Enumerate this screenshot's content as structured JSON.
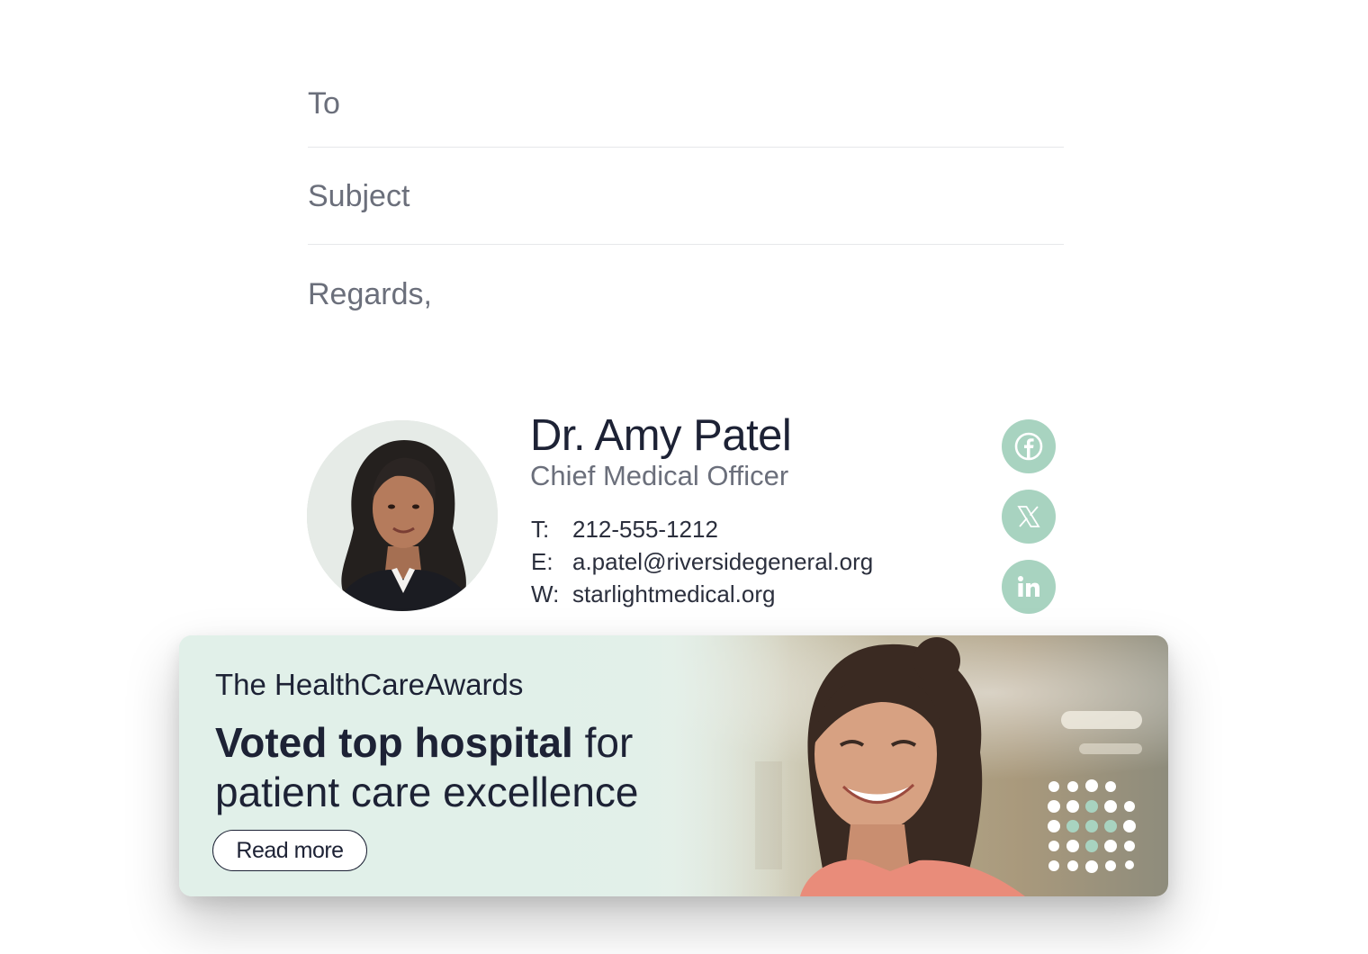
{
  "compose": {
    "to_label": "To",
    "subject_label": "Subject",
    "body_text": "Regards,"
  },
  "signature": {
    "name": "Dr. Amy Patel",
    "title": "Chief Medical Officer",
    "phone_key": "T:",
    "phone": "212-555-1212",
    "email_key": "E:",
    "email": "a.patel@riversidegeneral.org",
    "web_key": "W:",
    "website": "starlightmedical.org",
    "social": [
      {
        "icon": "facebook-icon"
      },
      {
        "icon": "x-icon"
      },
      {
        "icon": "linkedin-icon"
      }
    ],
    "accent_color": "#a8d3c0"
  },
  "banner": {
    "org": "The HealthCareAwards",
    "headline_bold": "Voted top hospital",
    "headline_rest_1": " for",
    "headline_rest_2": "patient care excellence",
    "cta_label": "Read more"
  }
}
